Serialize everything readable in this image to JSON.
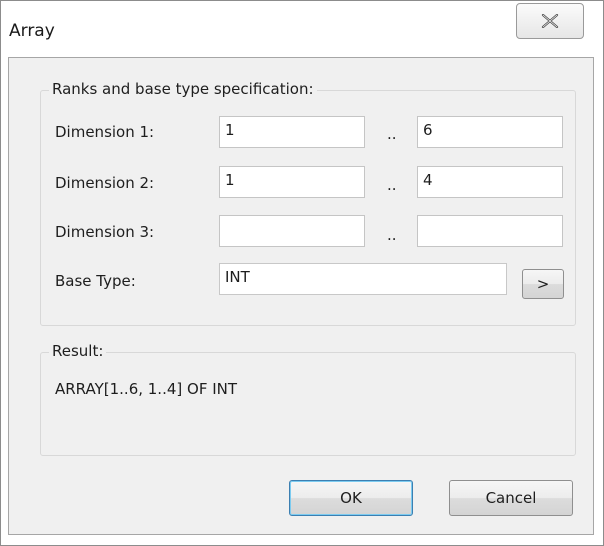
{
  "window": {
    "title": "Array"
  },
  "ranks_group": {
    "title": "Ranks and base type specification:",
    "dimensions": [
      {
        "label": "Dimension 1:",
        "lower": "1",
        "separator": "..",
        "upper": "6"
      },
      {
        "label": "Dimension 2:",
        "lower": "1",
        "separator": "..",
        "upper": "4"
      },
      {
        "label": "Dimension 3:",
        "lower": "",
        "separator": "..",
        "upper": ""
      }
    ],
    "base_type": {
      "label": "Base Type:",
      "value": "INT",
      "browse_label": ">"
    }
  },
  "result_group": {
    "title": "Result:",
    "text": "ARRAY[1..6, 1..4] OF INT"
  },
  "buttons": {
    "ok_label": "OK",
    "cancel_label": "Cancel"
  }
}
